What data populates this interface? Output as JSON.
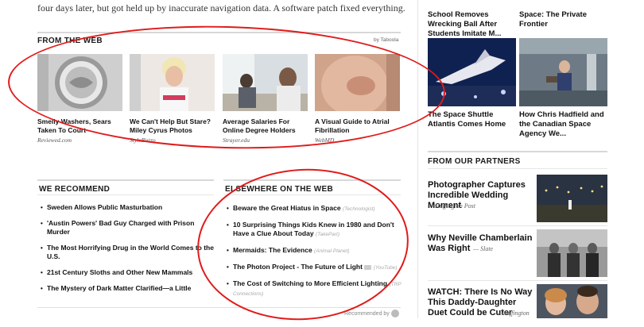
{
  "article": {
    "intro_text": "four days later, but got held up by inaccurate navigation data. A software patch fixed everything."
  },
  "from_the_web": {
    "heading": "FROM THE WEB",
    "sponsor": "by Taboola",
    "items": [
      {
        "caption": "Smelly Washers, Sears Taken To Court",
        "source": "Reviewed.com"
      },
      {
        "caption": "We Can't Help But Stare? Miley Cyrus Photos",
        "source": "StyleBistro"
      },
      {
        "caption": "Average Salaries For Online Degree Holders",
        "source": "Strayer.edu"
      },
      {
        "caption": "A Visual Guide to Atrial Fibrillation",
        "source": "WebMD"
      }
    ]
  },
  "we_recommend": {
    "heading": "WE RECOMMEND",
    "items": [
      "Sweden Allows Public Masturbation",
      "'Austin Powers' Bad Guy Charged with Prison Murder",
      "The Most Horrifying Drug in the World Comes to the U.S.",
      "21st Century Sloths and Other New Mammals",
      "The Mystery of Dark Matter Clarified—a Little"
    ]
  },
  "elsewhere": {
    "heading": "ELSEWHERE ON THE WEB",
    "items": [
      {
        "title": "Beware the Great Hiatus in Space",
        "source": "(Technologist)"
      },
      {
        "title": "10 Surprising Things Kids Knew in 1980 and Don't Have a Clue About Today",
        "source": "(TakePart)"
      },
      {
        "title": "Mermaids: The Evidence",
        "source": "(Animal Planet)"
      },
      {
        "title": "The Photon Project - The Future of Light",
        "source": "(YouTube)"
      },
      {
        "title": "The Cost of Switching to More Efficient Lighting",
        "source": "(TRP Connections)"
      }
    ]
  },
  "recommended_by": "Recommended by",
  "sidebar": {
    "top_captions": [
      "School Removes Wrecking Ball After Students Imitate M...",
      "Space: The Private Frontier"
    ],
    "tiles": [
      {
        "caption": "The Space Shuttle Atlantis Comes Home"
      },
      {
        "caption": "How Chris Hadfield and the Canadian Space Agency We..."
      }
    ],
    "partners_heading": "FROM OUR PARTNERS",
    "partners": [
      {
        "title": "Photographer Captures Incredible Wedding Moment",
        "source": "— Huffington Post"
      },
      {
        "title": "Why Neville Chamberlain Was Right",
        "source": "— Slate"
      },
      {
        "title": "WATCH: There Is No Way This Daddy-Daughter Duet Could be Cuter",
        "source": "— Huffington"
      }
    ]
  },
  "colors": {
    "annotation": "#e01b1b",
    "rule": "#d8d8d8"
  }
}
